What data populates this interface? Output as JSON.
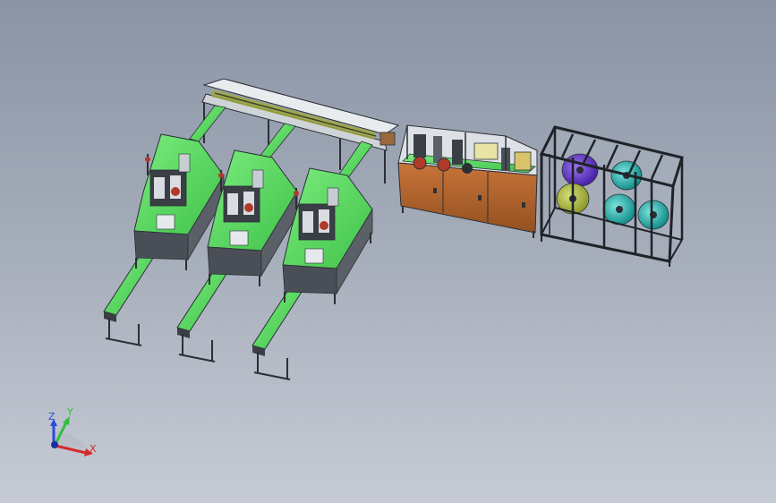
{
  "viewport": {
    "background_top": "#8a94a6",
    "background_bottom": "#c6cbd5"
  },
  "model": {
    "conveyor_color": "#63e067",
    "frame_color": "#2b2f35",
    "cabinet_color": "#b8652e",
    "spool_colors": [
      "#6f3fd1",
      "#1fb7b0",
      "#b9c64a"
    ]
  },
  "triad": {
    "z_label": "Z",
    "y_label": "Y",
    "x_label": "X",
    "z_color": "#2a4bd6",
    "y_color": "#2fbf3a",
    "x_color": "#d42a2a"
  }
}
